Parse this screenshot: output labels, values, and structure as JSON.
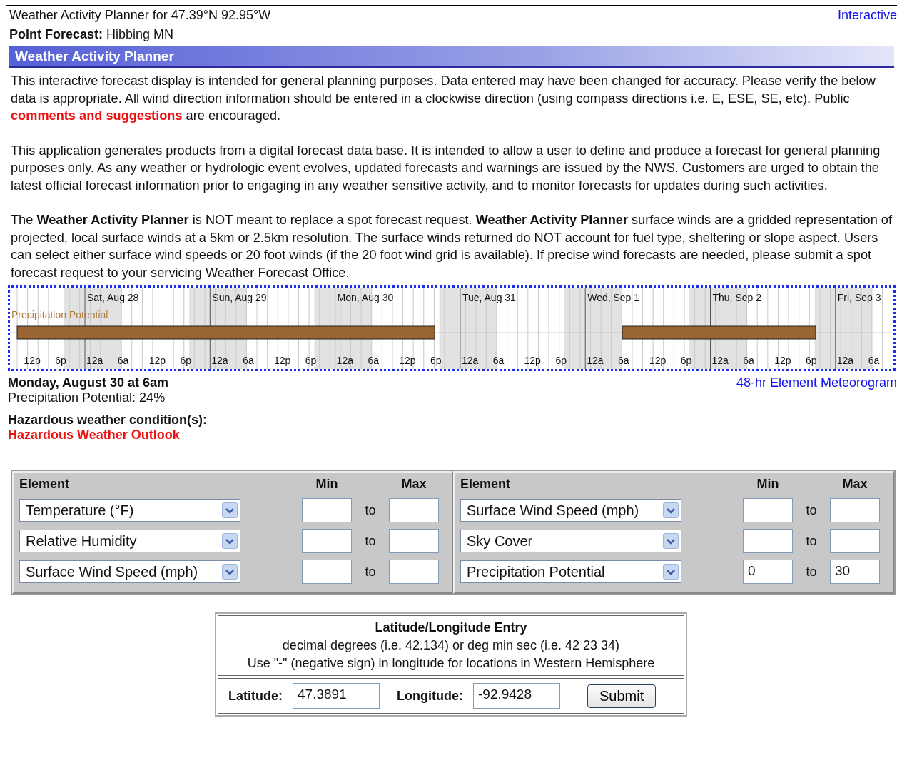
{
  "header": {
    "title": "Weather Activity Planner for 47.39°N 92.95°W",
    "link": "Interactive",
    "point_label": "Point Forecast:",
    "point_value": "Hibbing MN"
  },
  "section_title": "Weather Activity Planner",
  "intro": [
    {
      "kind": "text",
      "text": "This interactive forecast display is intended for general planning purposes. Data entered may have been changed for accuracy. Please verify the below data is appropriate. All wind direction information should be entered in a clockwise direction (using compass directions i.e. E, ESE, SE, etc). Public "
    },
    {
      "kind": "link",
      "text": "comments and suggestions"
    },
    {
      "kind": "text",
      "text": " are encouraged."
    }
  ],
  "paragraphs": [
    "This application generates products from a digital forecast data base. It is intended to allow a user to define and produce a forecast for general planning purposes only. As any weather or hydrologic event evolves, updated forecasts and warnings are issued by the NWS. Customers are urged to obtain the latest official forecast information prior to engaging in any weather sensitive activity, and to monitor forecasts for updates during such activities.",
    "The **Weather Activity Planner** is NOT meant to replace a spot forecast request. **Weather Activity Planner** surface winds are a gridded representation of projected, local surface winds at a 5km or 2.5km resolution. The surface winds returned do NOT account for fuel type, sheltering or slope aspect. Users can select either surface wind speeds or 20 foot winds (if the 20 foot wind grid is available). If precise wind forecasts are needed, please submit a spot forecast request to your servicing Weather Forecast Office."
  ],
  "timeline": {
    "series_label": "Precipitation Potential",
    "days": [
      "Sat, Aug 28",
      "Sun, Aug 29",
      "Mon, Aug 30",
      "Tue, Aug 31",
      "Wed, Sep 1",
      "Thu, Sep 2",
      "Fri, Sep 3"
    ],
    "hours": [
      "12p",
      "6p",
      "12a",
      "6a",
      "12p",
      "6p",
      "12a",
      "6a",
      "12p",
      "6p",
      "12a",
      "6a",
      "12p",
      "6p",
      "12a",
      "6a",
      "12p",
      "6p",
      "12a",
      "6a",
      "12p",
      "6p",
      "12a",
      "6a",
      "12p",
      "6p",
      "12a",
      "6a"
    ]
  },
  "detail": {
    "time": "Monday, August 30 at 6am",
    "link": "48-hr Element Meteorogram",
    "reading": "Precipitation Potential: 24%",
    "hazard_label": "Hazardous weather condition(s):",
    "hazard_link": "Hazardous Weather Outlook"
  },
  "elements": [
    {
      "headers": [
        "Element",
        "Min",
        "Max"
      ],
      "rows": [
        {
          "element": "Temperature (°F)",
          "to": "to"
        },
        {
          "element": "Relative Humidity",
          "to": "to"
        },
        {
          "element": "Surface Wind Speed (mph)",
          "to": "to"
        }
      ]
    },
    {
      "headers": [
        "Element",
        "Min",
        "Max"
      ],
      "rows": [
        {
          "element": "Surface Wind Speed (mph)",
          "to": "to"
        },
        {
          "element": "Sky Cover",
          "to": "to"
        },
        {
          "element": "Precipitation Potential",
          "min": "0",
          "to": "to",
          "max": "30"
        }
      ]
    }
  ],
  "latlon": {
    "title": "Latitude/Longitude Entry",
    "lines": [
      "decimal degrees (i.e. 42.134) or deg min sec (i.e. 42 23 34)",
      "Use \"-\" (negative sign) in longitude for locations in Western Hemisphere"
    ],
    "lat_label": "Latitude:",
    "lat_value": "47.3891",
    "lon_label": "Longitude:",
    "lon_value": "-92.9428",
    "submit": "Submit"
  }
}
